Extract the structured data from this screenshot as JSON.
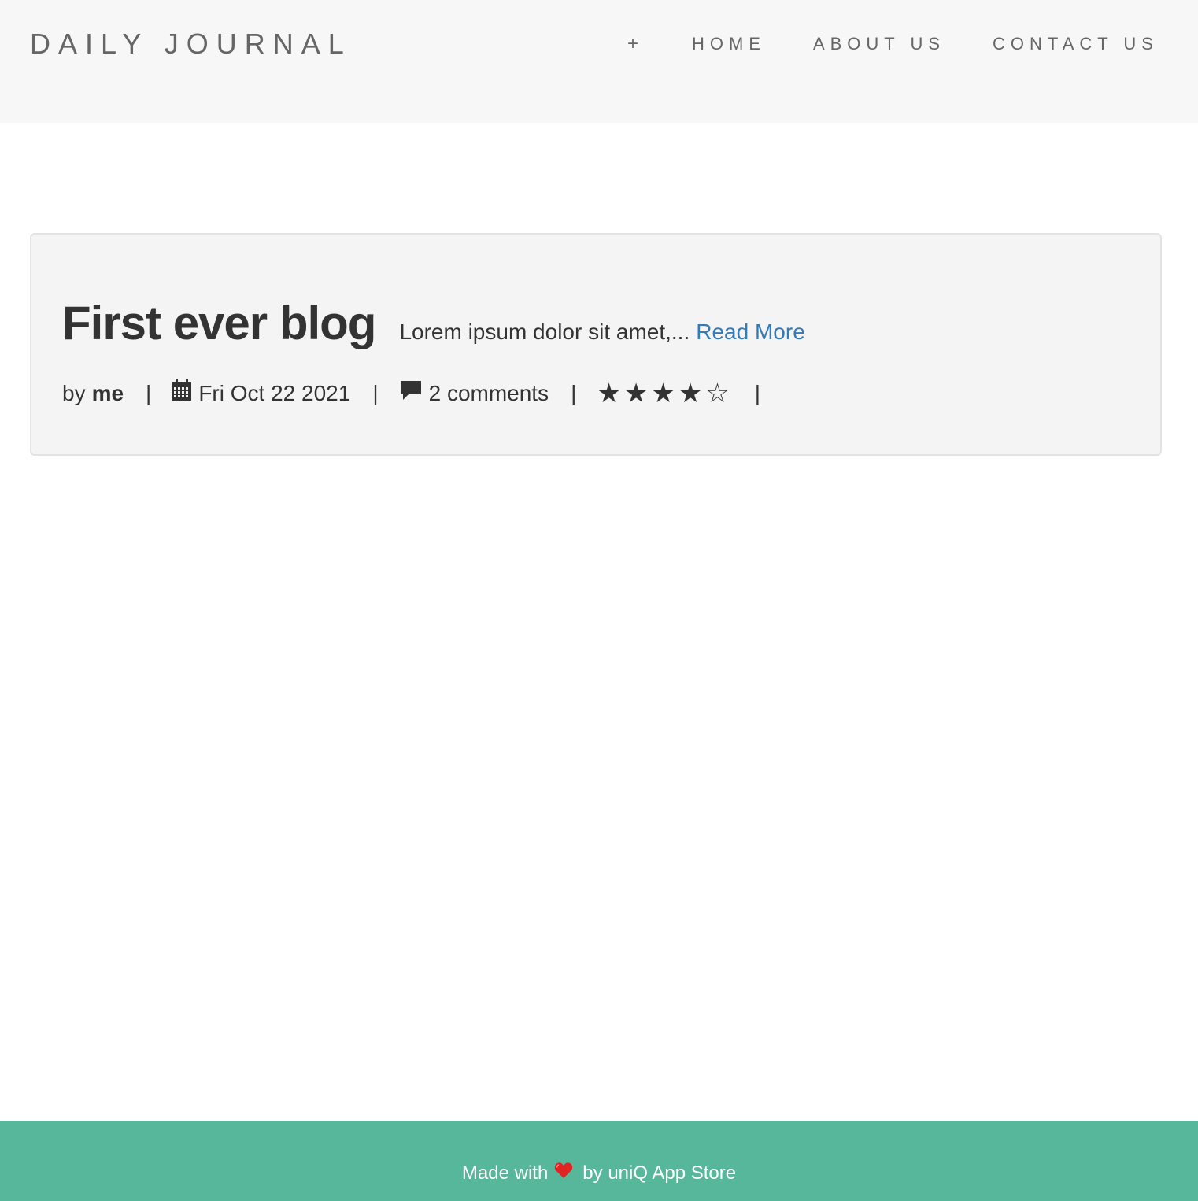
{
  "nav": {
    "brand": "DAILY JOURNAL",
    "plus": "+",
    "home": "HOME",
    "about": "ABOUT US",
    "contact": "CONTACT US"
  },
  "post": {
    "title": "First ever blog",
    "excerpt": "Lorem ipsum dolor sit amet,...",
    "read_more": "Read More",
    "by": "by",
    "author": "me",
    "date": "Fri Oct 22 2021",
    "comments": "2 comments",
    "separator": "|",
    "stars": "★★★★☆",
    "rating": 4,
    "rating_max": 5
  },
  "footer": {
    "made_with": "Made with",
    "by_text": "by uniQ App Store",
    "bg_color": "#57b79b"
  },
  "colors": {
    "link": "#337ab7",
    "navbar_bg": "#f7f7f7",
    "card_bg": "#f4f4f4"
  }
}
